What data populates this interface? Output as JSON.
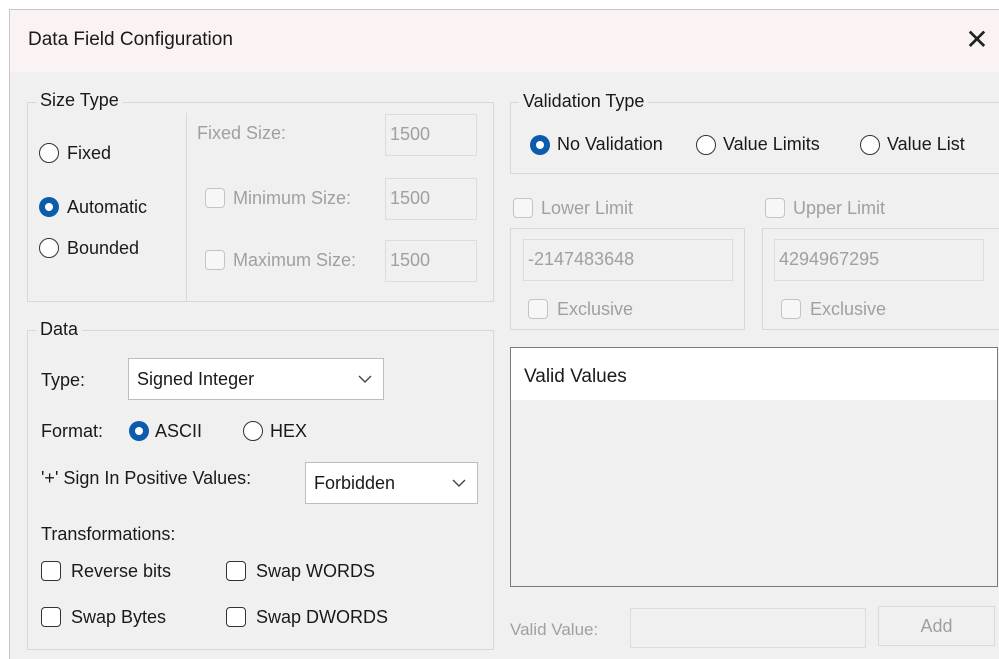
{
  "window": {
    "title": "Data Field Configuration",
    "close_glyph": "✕"
  },
  "size_type": {
    "legend": "Size Type",
    "options": [
      "Fixed",
      "Automatic",
      "Bounded"
    ],
    "selected": "Automatic",
    "fixed_size_label": "Fixed Size:",
    "fixed_size_value": "1500",
    "minimum_size_label": "Minimum Size:",
    "minimum_size_value": "1500",
    "maximum_size_label": "Maximum Size:",
    "maximum_size_value": "1500"
  },
  "data": {
    "legend": "Data",
    "type_label": "Type:",
    "type_value": "Signed Integer",
    "format_label": "Format:",
    "format_options": [
      "ASCII",
      "HEX"
    ],
    "format_selected": "ASCII",
    "sign_label": "'+' Sign In Positive Values:",
    "sign_value": "Forbidden",
    "transformations_label": "Transformations:",
    "transformations": [
      "Reverse bits",
      "Swap WORDS",
      "Swap Bytes",
      "Swap DWORDS"
    ]
  },
  "validation": {
    "legend": "Validation Type",
    "options": [
      "No Validation",
      "Value Limits",
      "Value List"
    ],
    "selected": "No Validation",
    "lower_limit_label": "Lower Limit",
    "lower_limit_value": "-2147483648",
    "upper_limit_label": "Upper Limit",
    "upper_limit_value": "4294967295",
    "exclusive_label": "Exclusive",
    "valid_values_header": "Valid Values",
    "valid_value_label": "Valid Value:",
    "valid_value_input": "",
    "add_label": "Add"
  },
  "icons": {
    "chevron": "chevron-down-icon",
    "close": "close-icon"
  },
  "colors": {
    "accent": "#0b5cad",
    "titlebar": "#fbf3f3",
    "dialog": "#f0f0f0",
    "disabled_text": "#a0a0a0"
  }
}
